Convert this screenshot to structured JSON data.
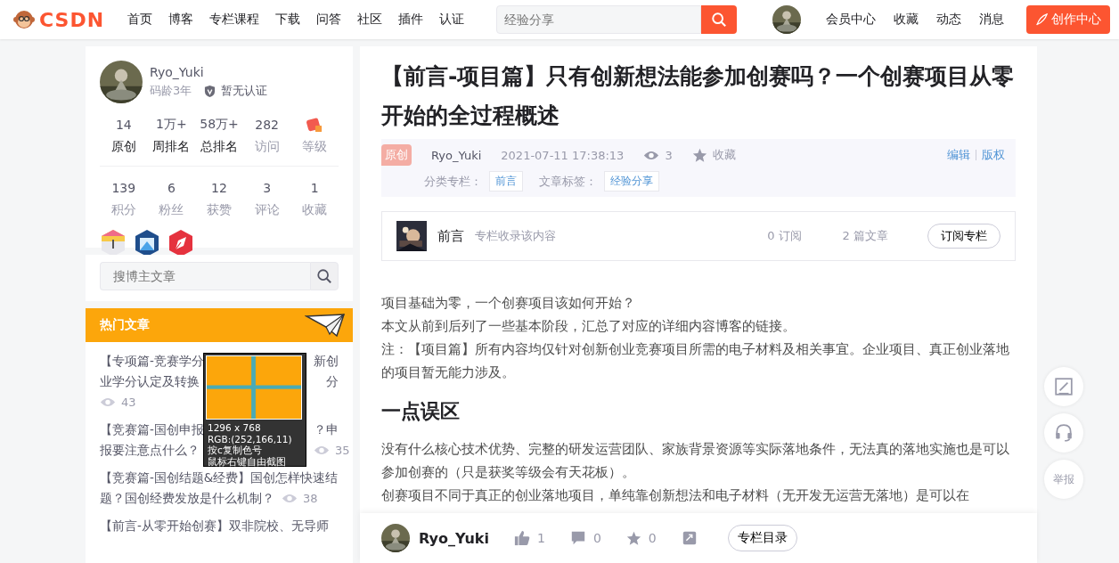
{
  "header": {
    "logo": "CSDN",
    "nav": [
      "首页",
      "博客",
      "专栏课程",
      "下载",
      "问答",
      "社区",
      "插件",
      "认证"
    ],
    "search": {
      "placeholder": "经验分享"
    },
    "links": [
      "会员中心",
      "收藏",
      "动态",
      "消息"
    ],
    "create_button": "创作中心"
  },
  "profile": {
    "name": "Ryo_Yuki",
    "code_age": "码龄3年",
    "certification": "暂无认证",
    "stats_top": [
      {
        "kind": "number",
        "value": "14",
        "label": "原创",
        "highlighted": true
      },
      {
        "kind": "number",
        "value": "1万+",
        "label": "周排名",
        "highlighted": true
      },
      {
        "kind": "number",
        "value": "58万+",
        "label": "总排名",
        "highlighted": true
      },
      {
        "kind": "number",
        "value": "282",
        "label": "访问",
        "highlighted": false
      },
      {
        "kind": "icon",
        "label": "等级",
        "highlighted": false
      }
    ],
    "stats_bottom": [
      {
        "kind": "number",
        "value": "139",
        "label": "积分",
        "highlighted": false
      },
      {
        "kind": "number",
        "value": "6",
        "label": "粉丝",
        "highlighted": false
      },
      {
        "kind": "number",
        "value": "12",
        "label": "获赞",
        "highlighted": false
      },
      {
        "kind": "number",
        "value": "3",
        "label": "评论",
        "highlighted": false
      },
      {
        "kind": "number",
        "value": "1",
        "label": "收藏",
        "highlighted": false
      }
    ]
  },
  "blog_search": {
    "placeholder": "搜博主文章"
  },
  "hot_articles": {
    "title": "热门文章",
    "items": [
      {
        "lines": [
          {
            "left": "【专项篇-竞赛学分",
            "right": "新创"
          },
          {
            "left": "业学分认定及转换",
            "right": "分"
          },
          {
            "views": "43"
          }
        ]
      },
      {
        "lines": [
          {
            "left": "【竞赛篇-国创申报",
            "right": "？申"
          },
          {
            "left": "报要注意点什么？",
            "views": "35"
          }
        ]
      },
      {
        "lines": [
          {
            "left": "【竞赛篇-国创结题&经费】国创怎样快速结"
          },
          {
            "left": "题？国创经费发放是什么机制？",
            "views": "38"
          }
        ]
      },
      {
        "lines": [
          {
            "left": "【前言-从零开始创赛】双非院校、无导师"
          }
        ]
      }
    ]
  },
  "color_picker": {
    "size": "1296 x 768",
    "rgb": "RGB:(252,166,11)",
    "hints": [
      "按c复制色号",
      "鼠标右键自由截图"
    ]
  },
  "article": {
    "title": "【前言-项目篇】只有创新想法能参加创赛吗？一个创赛项目从零开始的全过程概述",
    "meta": {
      "badge": "原创",
      "author": "Ryo_Yuki",
      "date": "2021-07-11 17:38:13",
      "views": "3",
      "favorite": "收藏",
      "edit": "编辑",
      "copyright": "版权",
      "category_label": "分类专栏：",
      "category": "前言",
      "tags_label": "文章标签：",
      "tags": [
        "经验分享"
      ]
    },
    "column": {
      "name": "前言",
      "description": "专栏收录该内容",
      "subscribers": "0 订阅",
      "articles": "2 篇文章",
      "button": "订阅专栏"
    },
    "body": [
      {
        "kind": "paragraph",
        "text": "项目基础为零，一个创赛项目该如何开始？"
      },
      {
        "kind": "paragraph",
        "text": "本文从前到后列了一些基本阶段，汇总了对应的详细内容博客的链接。"
      },
      {
        "kind": "paragraph",
        "text": "注：【项目篇】所有内容均仅针对创新创业竞赛项目所需的电子材料及相关事宜。企业项目、真正创业落地的项目暂无能力涉及。"
      },
      {
        "kind": "heading",
        "text": "一点误区"
      },
      {
        "kind": "paragraph",
        "text": "没有什么核心技术优势、完整的研发运营团队、家族背景资源等实际落地条件，无法真的落地实施也是可以参加创赛的（只是获奖等级会有天花板）。"
      },
      {
        "kind": "paragraph",
        "text": "创赛项目不同于真正的创业落地项目，单纯靠创新想法和电子材料（无开发无运营无落地）是可以在"
      }
    ]
  },
  "bottom_bar": {
    "author": "Ryo_Yuki",
    "likes": "1",
    "comments": "0",
    "favorites": "0",
    "toc_button": "专栏目录"
  },
  "float_buttons": [
    {
      "kind": "icon"
    },
    {
      "kind": "icon"
    },
    {
      "kind": "text",
      "label": "举报"
    }
  ]
}
